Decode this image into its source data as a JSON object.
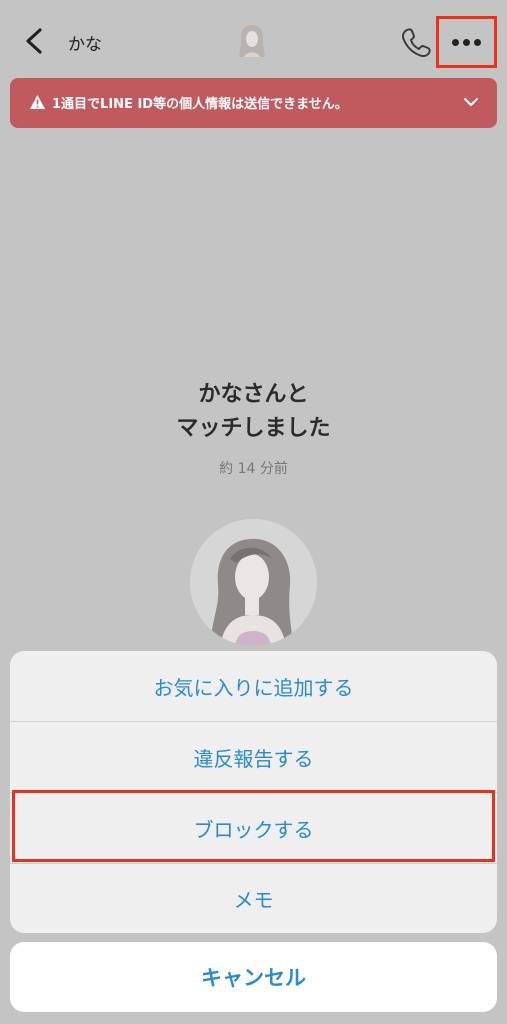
{
  "header": {
    "name": "かな",
    "back_icon": "chevron-left-icon",
    "phone_icon": "phone-icon",
    "more_icon": "more-horizontal-icon"
  },
  "warning": {
    "text": "1通目でLINE ID等の個人情報は送信できません。",
    "icon": "warning-triangle-icon",
    "chevron": "chevron-down-icon"
  },
  "match": {
    "title_line1": "かなさんと",
    "title_line2": "マッチしました",
    "time": "約 14 分前"
  },
  "sheet": {
    "items": [
      {
        "label": "お気に入りに追加する"
      },
      {
        "label": "違反報告する"
      },
      {
        "label": "ブロックする"
      },
      {
        "label": "メモ"
      }
    ],
    "cancel": "キャンセル"
  },
  "colors": {
    "overlay": "#c4c4c4",
    "warning_bg": "#c05a5e",
    "action_blue": "#2a8ad4",
    "highlight_red": "#e8321c"
  }
}
